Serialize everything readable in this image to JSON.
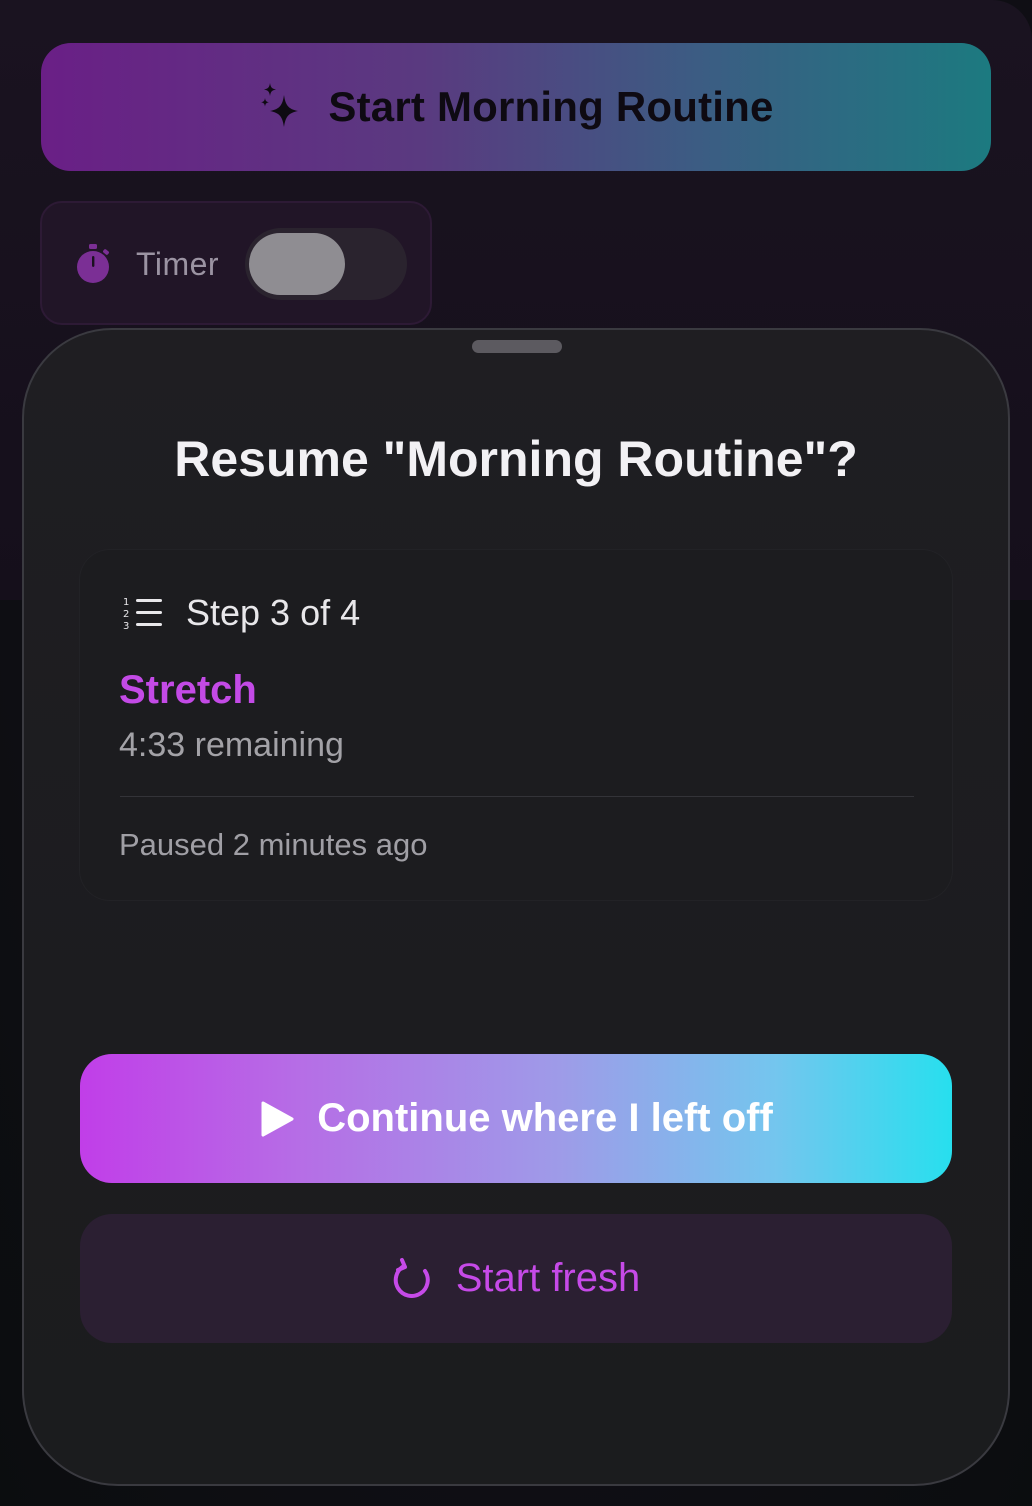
{
  "background": {
    "start_routine_label": "Start Morning Routine",
    "timer_label": "Timer",
    "timer_enabled": false
  },
  "sheet": {
    "title": "Resume \"Morning Routine\"?",
    "step_label": "Step 3 of 4",
    "step_name": "Stretch",
    "remaining": "4:33 remaining",
    "paused": "Paused 2 minutes ago",
    "continue_label": "Continue where I left off",
    "fresh_label": "Start fresh"
  },
  "colors": {
    "accent": "#c34ae6",
    "cyan": "#27dfee"
  },
  "icons": {
    "sparkle": "sparkle-icon",
    "stopwatch": "stopwatch-icon",
    "list": "numbered-list-icon",
    "play": "play-icon",
    "refresh": "refresh-icon"
  }
}
